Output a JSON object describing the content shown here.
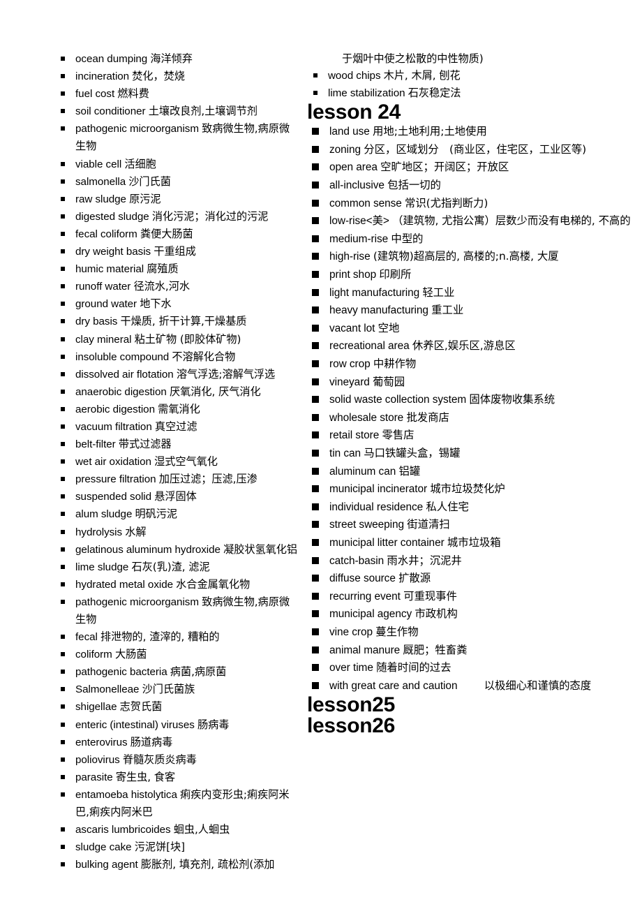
{
  "page": {
    "background_color": "#ffffff",
    "text_color": "#000000"
  },
  "left_column": {
    "bullet_style": "small-filled-square",
    "items": [
      {
        "term": "ocean dumping",
        "gloss": "海洋倾弃"
      },
      {
        "term": "incineration",
        "gloss": "焚化，焚烧"
      },
      {
        "term": "fuel cost",
        "gloss": "燃料费"
      },
      {
        "term": "soil conditioner",
        "gloss": "土壤改良剂,土壤调节剂"
      },
      {
        "term": "pathogenic microorganism",
        "gloss": "致病微生物,病原微生物"
      },
      {
        "term": "viable cell",
        "gloss": "活细胞"
      },
      {
        "term": "salmonella",
        "gloss": "沙门氏菌"
      },
      {
        "term": "raw sludge",
        "gloss": "原污泥"
      },
      {
        "term": "digested sludge",
        "gloss": "消化污泥；消化过的污泥"
      },
      {
        "term": "fecal coliform",
        "gloss": "粪便大肠菌"
      },
      {
        "term": "dry weight basis",
        "gloss": "干重组成"
      },
      {
        "term": "humic material",
        "gloss": "腐殖质"
      },
      {
        "term": "runoff water",
        "gloss": "径流水,河水"
      },
      {
        "term": "ground water",
        "gloss": "地下水"
      },
      {
        "term": "dry basis",
        "gloss": "干燥质, 折干计算,干燥基质"
      },
      {
        "term": "clay mineral",
        "gloss": "粘土矿物  (即胶体矿物)"
      },
      {
        "term": "insoluble compound",
        "gloss": "不溶解化合物"
      },
      {
        "term": "dissolved air flotation",
        "gloss": "溶气浮选;溶解气浮选"
      },
      {
        "term": "anaerobic digestion",
        "gloss": "厌氧消化, 厌气消化"
      },
      {
        "term": "aerobic digestion",
        "gloss": "需氧消化"
      },
      {
        "term": "vacuum filtration",
        "gloss": "真空过滤"
      },
      {
        "term": "belt-filter",
        "gloss": "带式过滤器"
      },
      {
        "term": "wet air oxidation",
        "gloss": "湿式空气氧化"
      },
      {
        "term": "pressure filtration",
        "gloss": "加压过滤；压滤,压渗"
      },
      {
        "term": "suspended solid",
        "gloss": "悬浮固体"
      },
      {
        "term": "alum sludge",
        "gloss": "明矾污泥"
      },
      {
        "term": "hydrolysis",
        "gloss": "水解"
      },
      {
        "term": "gelatinous aluminum hydroxide",
        "gloss": "凝胶状氢氧化铝"
      },
      {
        "term": "lime sludge",
        "gloss": "石灰(乳)渣, 滤泥"
      },
      {
        "term": "hydrated metal oxide",
        "gloss": "水合金属氧化物"
      },
      {
        "term": "pathogenic microorganism",
        "gloss": "致病微生物,病原微生物"
      },
      {
        "term": "fecal",
        "gloss": "排泄物的, 渣滓的, 糟粕的"
      },
      {
        "term": "coliform",
        "gloss": "大肠菌"
      },
      {
        "term": "pathogenic bacteria",
        "gloss": "病菌,病原菌"
      },
      {
        "term": "Salmonelleae",
        "gloss": "沙门氏菌族"
      },
      {
        "term": "shigellae",
        "gloss": "志贺氏菌"
      },
      {
        "term": "enteric (intestinal) viruses",
        "gloss": " 肠病毒"
      },
      {
        "term": "enterovirus",
        "gloss": "肠道病毒"
      },
      {
        "term": "poliovirus",
        "gloss": "脊髓灰质炎病毒"
      },
      {
        "term": "parasite",
        "gloss": "寄生虫, 食客"
      },
      {
        "term": "entamoeba histolytica",
        "gloss": "痢疾内变形虫;痢疾阿米巴,痢疾内阿米巴"
      },
      {
        "term": "ascaris lumbricoides",
        "gloss": "蛔虫,人蛔虫"
      },
      {
        "term": "sludge cake",
        "gloss": "污泥饼[块]"
      },
      {
        "term": "bulking agent",
        "gloss": "膨胀剂, 填充剂, 疏松剂(添加"
      }
    ]
  },
  "right_column": {
    "orphan_line": "于烟叶中使之松散的中性物质)",
    "continued_items": {
      "bullet_style": "small-filled-square",
      "items": [
        {
          "term": "wood chips",
          "gloss": "木片, 木屑, 刨花"
        },
        {
          "term": "lime stabilization",
          "gloss": "石灰稳定法"
        }
      ]
    },
    "lesson_24": {
      "heading": "lesson 24",
      "bullet_style": "large-filled-square",
      "items": [
        {
          "term": "land use",
          "gloss": "用地;土地利用;土地使用"
        },
        {
          "term": "zoning",
          "gloss": "分区，区域划分　(商业区，住宅区，工业区等)"
        },
        {
          "term": "open area",
          "gloss": "空旷地区；开阔区；开放区"
        },
        {
          "term": "all-inclusive",
          "gloss": "包括一切的"
        },
        {
          "term": "common sense",
          "gloss": "常识(尤指判断力)"
        },
        {
          "term": "low-rise<美>",
          "gloss": "（建筑物, 尤指公寓）层数少而没有电梯的, 不高的"
        },
        {
          "term": "medium-rise",
          "gloss": "中型的"
        },
        {
          "term": "high-rise",
          "gloss": "(建筑物)超高层的, 高楼的;n.高楼, 大厦"
        },
        {
          "term": "print shop",
          "gloss": "印刷所"
        },
        {
          "term": "light manufacturing",
          "gloss": "轻工业"
        },
        {
          "term": "heavy manufacturing",
          "gloss": "重工业"
        },
        {
          "term": "vacant lot",
          "gloss": "空地"
        },
        {
          "term": "recreational area",
          "gloss": "休养区,娱乐区,游息区"
        },
        {
          "term": "row crop",
          "gloss": "中耕作物"
        },
        {
          "term": "vineyard",
          "gloss": "葡萄园"
        },
        {
          "term": "solid waste collection system",
          "gloss": "固体废物收集系统"
        },
        {
          "term": "wholesale store",
          "gloss": "批发商店"
        },
        {
          "term": "retail store",
          "gloss": "零售店"
        },
        {
          "term": "tin can",
          "gloss": "马口铁罐头盒，锡罐"
        },
        {
          "term": "aluminum can",
          "gloss": "铝罐"
        },
        {
          "term": "municipal incinerator",
          "gloss": "城市垃圾焚化炉"
        },
        {
          "term": "individual residence",
          "gloss": "私人住宅"
        },
        {
          "term": "street sweeping",
          "gloss": "街道清扫"
        },
        {
          "term": "municipal litter container",
          "gloss": " 城市垃圾箱"
        },
        {
          "term": "catch-basin",
          "gloss": "雨水井；沉泥井"
        },
        {
          "term": "diffuse source",
          "gloss": "扩散源"
        },
        {
          "term": "recurring event",
          "gloss": " 可重现事件"
        },
        {
          "term": "municipal agency",
          "gloss": "市政机构"
        },
        {
          "term": "vine crop",
          "gloss": "蔓生作物"
        },
        {
          "term": "animal manure",
          "gloss": "厩肥；牲畜粪"
        },
        {
          "term": "over time",
          "gloss": "随着时间的过去"
        },
        {
          "term": "with great care and caution",
          "gloss": "以极细心和谨慎的态度"
        }
      ]
    },
    "lesson_25": {
      "heading": "lesson25"
    },
    "lesson_26": {
      "heading": "lesson26"
    }
  }
}
